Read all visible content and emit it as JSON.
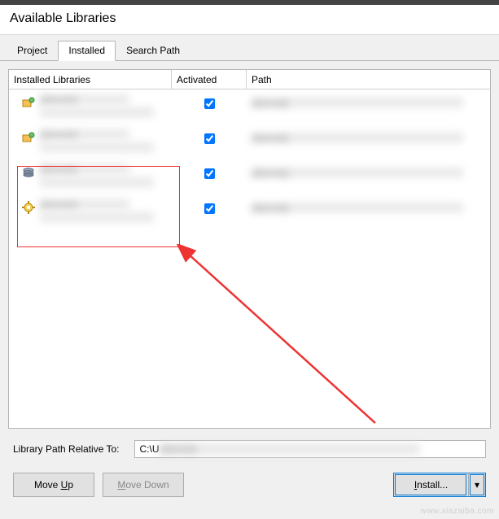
{
  "window": {
    "title": "Available Libraries"
  },
  "tabs": {
    "project": "Project",
    "installed": "Installed",
    "search_path": "Search Path",
    "active": "Installed"
  },
  "columns": {
    "lib": "Installed Libraries",
    "activated": "Activated",
    "path": "Path"
  },
  "rows": [
    {
      "name": "(blurred)",
      "activated": true,
      "path": "(blurred)",
      "icon": "package-network"
    },
    {
      "name": "(blurred)",
      "activated": true,
      "path": "(blurred)",
      "icon": "package-network"
    },
    {
      "name": "(blurred)",
      "activated": true,
      "path": "(blurred)",
      "icon": "stack"
    },
    {
      "name": "(blurred)",
      "activated": true,
      "path": "(blurred)",
      "icon": "gear"
    }
  ],
  "library_path": {
    "label": "Library Path Relative To:",
    "value_prefix": "C:\\U",
    "value_rest": "(blurred)"
  },
  "buttons": {
    "move_up": "Move Up",
    "move_down": "Move Down",
    "install": "Install...",
    "install_arrow": "▾"
  },
  "watermark": "www.xiazaiba.com"
}
